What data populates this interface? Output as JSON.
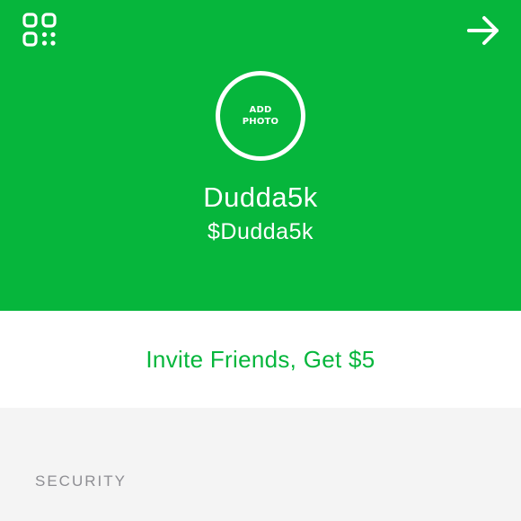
{
  "profile": {
    "add_photo_label": "ADD PHOTO",
    "display_name": "Dudda5k",
    "cashtag": "$Dudda5k"
  },
  "toolbar": {
    "left_icon": "qr-code-icon",
    "right_icon": "arrow-right-icon"
  },
  "invite": {
    "label": "Invite Friends, Get $5"
  },
  "sections": {
    "security_title": "SECURITY"
  },
  "colors": {
    "brand_green": "#06b63c",
    "background_gray": "#f4f4f4",
    "section_text": "#8e8e93",
    "white": "#ffffff"
  }
}
